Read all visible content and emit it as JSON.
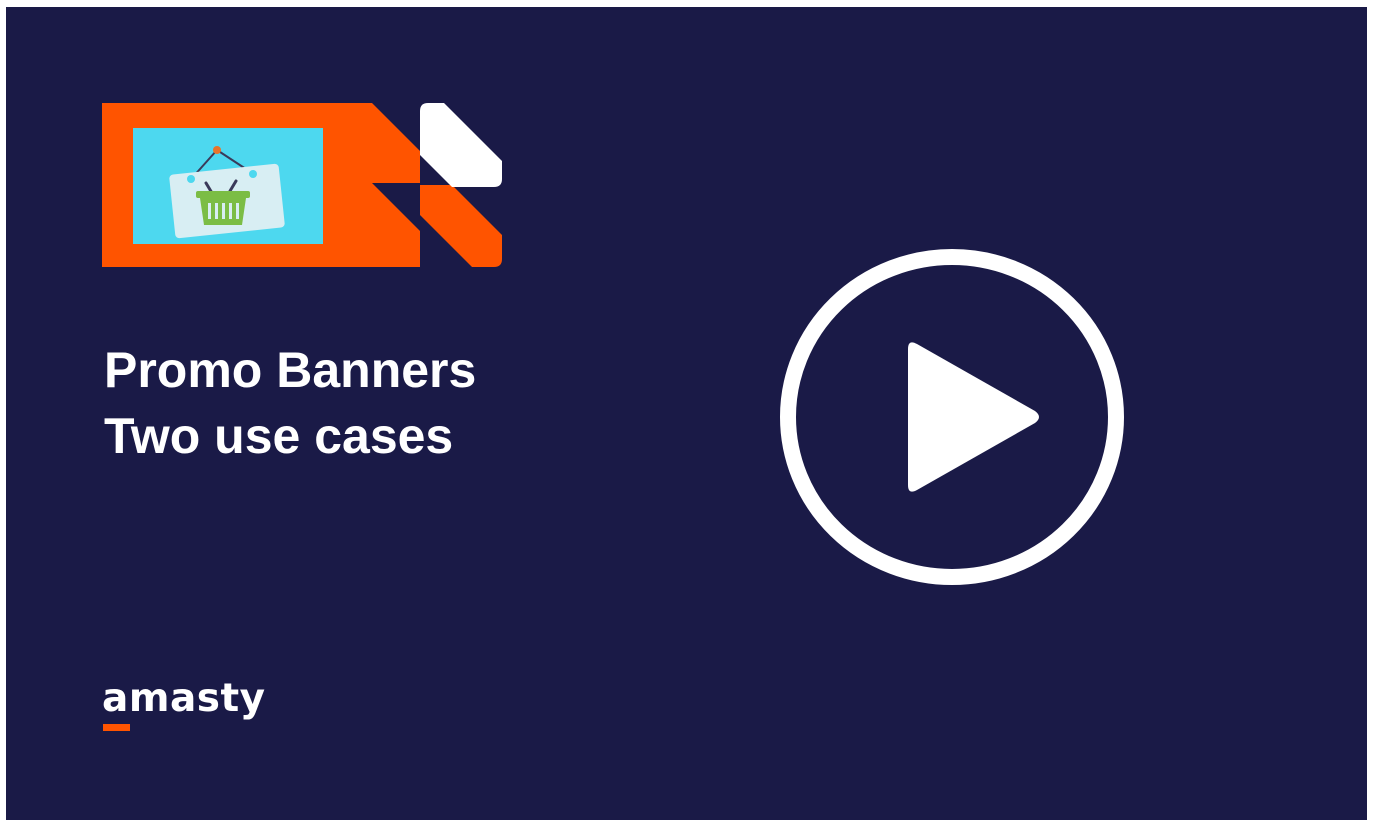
{
  "colors": {
    "background": "#1a1a47",
    "accent": "#ff5400",
    "screen": "#4dd8ef",
    "white": "#ffffff",
    "basket": "#7bbd45"
  },
  "video": {
    "title_line1": "Promo Banners",
    "title_line2": "Two use cases"
  },
  "brand": {
    "logo_text": "amasty"
  },
  "icons": {
    "play": "play-icon",
    "banner": "promo-banner-icon",
    "basket": "shopping-basket-icon"
  }
}
